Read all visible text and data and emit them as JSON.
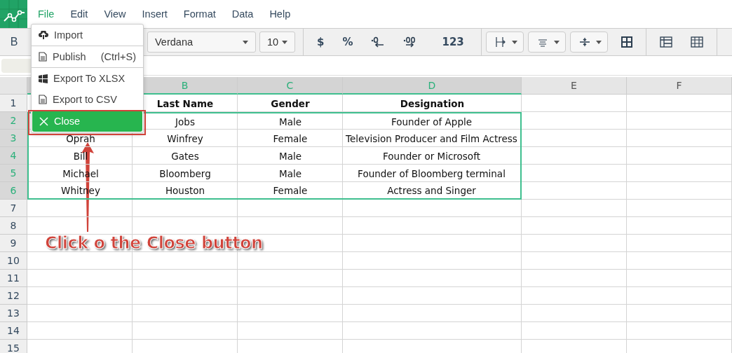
{
  "menubar": [
    {
      "label": "File",
      "selected": true
    },
    {
      "label": "Edit",
      "selected": false
    },
    {
      "label": "View",
      "selected": false
    },
    {
      "label": "Insert",
      "selected": false
    },
    {
      "label": "Format",
      "selected": false
    },
    {
      "label": "Data",
      "selected": false
    },
    {
      "label": "Help",
      "selected": false
    }
  ],
  "toolbar": {
    "bold_label": "B",
    "font": "Verdana",
    "size": "10",
    "number_buttons": [
      "$",
      "%",
      "123"
    ]
  },
  "file_menu": [
    {
      "kind": "import",
      "label": "Import",
      "selected": false
    },
    {
      "kind": "document",
      "label": "Publish",
      "shortcut": "(Ctrl+S)",
      "selected": false
    },
    {
      "kind": "windows",
      "label": "Export To XLSX",
      "selected": false
    },
    {
      "kind": "document",
      "label": "Export to CSV",
      "selected": false
    },
    {
      "kind": "close",
      "label": "Close",
      "selected": true
    }
  ],
  "columns": [
    {
      "selected": true
    },
    {
      "label": "B",
      "selected": true
    },
    {
      "label": "C",
      "selected": true
    },
    {
      "label": "D",
      "selected": true
    },
    {
      "label": "E",
      "selected": false
    },
    {
      "label": "F",
      "selected": false
    }
  ],
  "rows": [
    {
      "number": "1",
      "selected": false,
      "kind": "header",
      "cells": [
        {},
        {
          "text": "Last Name"
        },
        {
          "text": "Gender"
        },
        {
          "text": "Designation"
        }
      ]
    },
    {
      "number": "2",
      "selected": true,
      "cells": [
        {},
        {
          "text": "Jobs"
        },
        {
          "text": "Male"
        },
        {
          "text": "Founder of Apple"
        }
      ]
    },
    {
      "number": "3",
      "selected": true,
      "cells": [
        {
          "text": "Oprah"
        },
        {
          "text": "Winfrey"
        },
        {
          "text": "Female"
        },
        {
          "text": "Television Producer and Film Actress"
        }
      ]
    },
    {
      "number": "4",
      "selected": true,
      "cells": [
        {
          "text": "Bill"
        },
        {
          "text": "Gates"
        },
        {
          "text": "Male"
        },
        {
          "text": "Founder or Microsoft"
        }
      ]
    },
    {
      "number": "5",
      "selected": true,
      "cells": [
        {
          "text": "Michael"
        },
        {
          "text": "Bloomberg"
        },
        {
          "text": "Male"
        },
        {
          "text": "Founder of Bloomberg terminal"
        }
      ]
    },
    {
      "number": "6",
      "selected": true,
      "cells": [
        {
          "text": "Whitney"
        },
        {
          "text": "Houston"
        },
        {
          "text": "Female"
        },
        {
          "text": "Actress and Singer"
        }
      ]
    },
    {
      "number": "7",
      "selected": false
    },
    {
      "number": "8",
      "selected": false
    },
    {
      "number": "9",
      "selected": false
    },
    {
      "number": "10",
      "selected": false
    },
    {
      "number": "11",
      "selected": false
    },
    {
      "number": "12",
      "selected": false
    },
    {
      "number": "13",
      "selected": false
    },
    {
      "number": "14",
      "selected": false
    },
    {
      "number": "15",
      "selected": false
    }
  ],
  "annotation": {
    "text": "Click o the Close button"
  }
}
